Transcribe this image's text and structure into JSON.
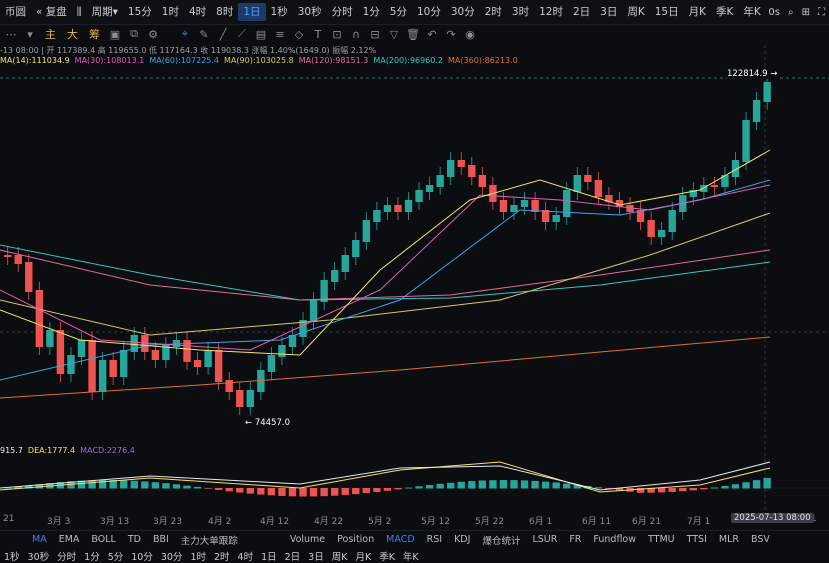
{
  "topbar": {
    "title": "币圆",
    "adjust": "复盘",
    "period_label": "周期",
    "intervals": [
      "15分",
      "1时",
      "4时",
      "8时",
      "1日",
      "1秒",
      "30秒",
      "分时",
      "1分",
      "5分",
      "10分",
      "30分",
      "2时",
      "3时",
      "12时",
      "2日",
      "3日",
      "周K",
      "15日",
      "月K",
      "季K",
      "年K"
    ],
    "active_interval": "1日",
    "right_time": "0s",
    "right_icons": [
      "search-icon",
      "grid-icon",
      "fullscreen-icon"
    ]
  },
  "toolbar": {
    "labels": [
      "主",
      "大",
      "筹"
    ]
  },
  "info": {
    "line1": "-13 08:00 | 开 117389.4 高 119655.0 低 117164.3 收 119038.3 涨幅 1.40%(1649.0) 振幅 2.12%",
    "ma": [
      {
        "label": "MA(14):111034.9",
        "color": "#f4e36c"
      },
      {
        "label": "MA(30):108013.1",
        "color": "#e05fb8"
      },
      {
        "label": "MA(60):107225.4",
        "color": "#3fa3e8"
      },
      {
        "label": "MA(90):103025.8",
        "color": "#d6c66a"
      },
      {
        "label": "MA(120):98151.3",
        "color": "#e36b9a"
      },
      {
        "label": "MA(200):96960.2",
        "color": "#36c6c6"
      },
      {
        "label": "MA(360):86213.0",
        "color": "#e0702c"
      }
    ]
  },
  "macd_info": [
    {
      "label": "915.7",
      "color": "#e9e9e9"
    },
    {
      "label": "DEA:1777.4",
      "color": "#f4e36c"
    },
    {
      "label": "MACD:2276.4",
      "color": "#9b70d6"
    }
  ],
  "price_tags": {
    "high": "122814.9",
    "low": "74457.0"
  },
  "date_tag": "2025-07-13 08:00",
  "x_labels": [
    "21",
    "3月 3",
    "3月 13",
    "3月 23",
    "4月 2",
    "4月 12",
    "4月 22",
    "5月 2",
    "5月 12",
    "5月 22",
    "6月 1",
    "6月 11",
    "6月 21",
    "7月 1",
    "21"
  ],
  "indicators": [
    "MA",
    "EMA",
    "BOLL",
    "TD",
    "BBI",
    "主力大单跟踪",
    "Volume",
    "Position",
    "MACD",
    "RSI",
    "KDJ",
    "爆仓统计",
    "LSUR",
    "FR",
    "Fundflow",
    "TTMU",
    "TTSI",
    "MLR",
    "BSV"
  ],
  "active_indicator": "MACD",
  "bottom_intervals": [
    "1秒",
    "30秒",
    "分时",
    "1分",
    "5分",
    "10分",
    "30分",
    "1时",
    "2时",
    "4时",
    "1日",
    "2日",
    "3日",
    "周K",
    "月K",
    "季K",
    "年K"
  ],
  "colors": {
    "up": "#26a69a",
    "down": "#ef5350",
    "accent": "#3b82f6"
  }
}
